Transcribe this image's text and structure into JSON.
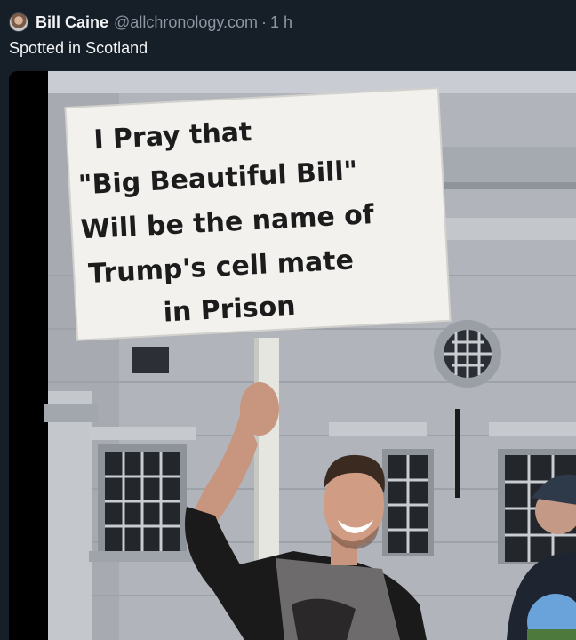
{
  "post": {
    "author_name": "Bill Caine",
    "handle": "@allchronology.com",
    "separator": "·",
    "time": "1 h",
    "text": "Spotted in Scotland"
  },
  "media": {
    "sign_lines": [
      "I Pray that",
      "\"Big Beautiful Bill\"",
      "Will be the name of",
      "Trump's cell mate",
      "in Prison"
    ]
  }
}
